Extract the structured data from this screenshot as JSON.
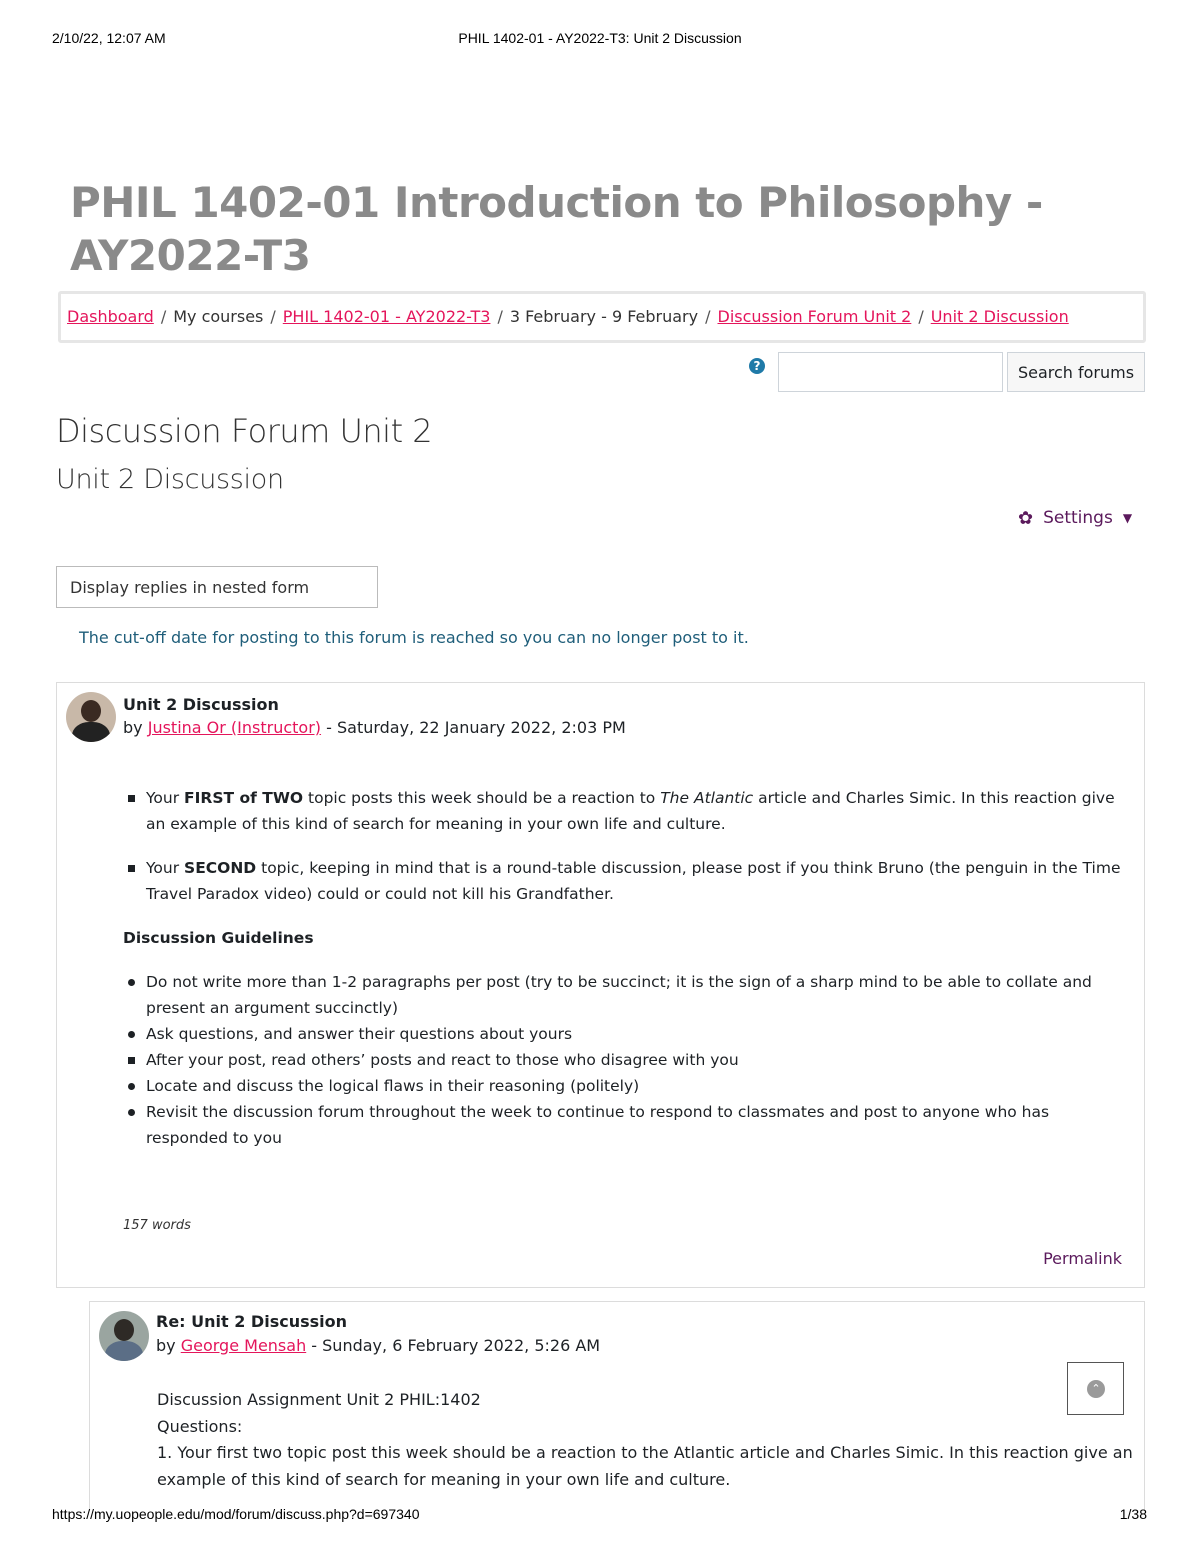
{
  "print_header": {
    "date": "2/10/22, 12:07 AM",
    "title": "PHIL 1402-01 - AY2022-T3: Unit 2 Discussion"
  },
  "print_footer": {
    "url": "https://my.uopeople.edu/mod/forum/discuss.php?d=697340",
    "page": "1/38"
  },
  "course_title": "PHIL 1402-01 Introduction to Philosophy - AY2022-T3",
  "breadcrumb": {
    "items": [
      {
        "label": "Dashboard"
      },
      {
        "label": "My courses"
      },
      {
        "label": "PHIL 1402-01 - AY2022-T3"
      },
      {
        "label": "3 February - 9 February"
      },
      {
        "label": "Discussion Forum Unit 2"
      },
      {
        "label": "Unit 2 Discussion"
      }
    ],
    "separator": "/"
  },
  "search": {
    "help_icon": "question-circle-icon",
    "help_glyph": "?",
    "value": "",
    "button_label": "Search forums"
  },
  "forum_title": "Discussion Forum Unit 2",
  "discussion_title": "Unit 2 Discussion",
  "settings": {
    "label": "Settings",
    "icon": "gear-icon",
    "glyph": "✿",
    "caret": "▼"
  },
  "display_mode": {
    "selected": "Display replies in nested form"
  },
  "cutoff_notice": "The cut-off date for posting to this forum is reached so you can no longer post to it.",
  "posts": [
    {
      "subject": "Unit 2 Discussion",
      "by": "by",
      "author": "Justina Or (Instructor)",
      "date": " - Saturday, 22 January 2022, 2:03 PM",
      "topics": [
        {
          "pre": "Your ",
          "bold": "FIRST of TWO",
          "mid": " topic posts this week should be a reaction to ",
          "italic": "The Atlantic",
          "post": " article and Charles Simic. In this reaction give an example of this kind of search for meaning in your own life and culture."
        },
        {
          "pre": "Your ",
          "bold": "SECOND",
          "post": " topic, keeping in mind that is a round-table discussion, please post if you think Bruno (the penguin in the Time Travel Paradox video) could or could not kill his Grandfather."
        }
      ],
      "guidelines_heading": "Discussion Guidelines",
      "guidelines": [
        "Do not write more than 1-2 paragraphs per post (try to be succinct; it is the sign of a sharp mind to be able to collate and present an argument succinctly)",
        "Ask questions, and answer their questions about yours",
        "After your post, read others’ posts and react to those who disagree with you",
        "Locate and discuss the logical flaws in their reasoning (politely)",
        "Revisit the discussion forum throughout the week to continue to respond to classmates and post to anyone who has responded to you"
      ],
      "word_count": "157 words",
      "permalink": "Permalink"
    },
    {
      "subject": "Re: Unit 2 Discussion",
      "by": "by",
      "author": "George Mensah",
      "date": " - Sunday, 6 February 2022, 5:26 AM",
      "lines": [
        "Discussion Assignment Unit 2 PHIL:1402",
        "Questions:",
        "1. Your first two topic post this week should be a reaction to the Atlantic article and Charles Simic. In this reaction give an example of this kind of search for meaning in your own life and culture."
      ]
    }
  ],
  "scroll_top": {
    "icon": "chevron-up-circle-icon",
    "glyph": "⌃"
  }
}
